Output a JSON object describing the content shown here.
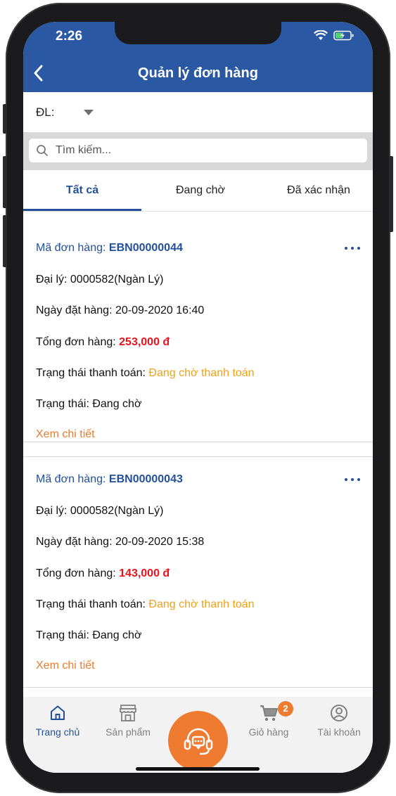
{
  "status_bar": {
    "time": "2:26"
  },
  "header": {
    "title": "Quản lý đơn hàng"
  },
  "filter": {
    "label": "ĐL:"
  },
  "search": {
    "placeholder": "Tìm kiếm..."
  },
  "tabs": [
    {
      "label": "Tất cả"
    },
    {
      "label": "Đang chờ"
    },
    {
      "label": "Đã xác nhận"
    }
  ],
  "orders": [
    {
      "code_label": "Mã đơn hàng:",
      "code": "EBN00000044",
      "agent_label": "Đại lý:",
      "agent": "0000582(Ngàn Lý)",
      "date_label": "Ngày đặt hàng:",
      "date": "20-09-2020 16:40",
      "total_label": "Tổng đơn hàng:",
      "total": "253,000 đ",
      "payment_label": "Trạng thái thanh toán:",
      "payment_status": "Đang chờ thanh toán",
      "status_label": "Trạng thái:",
      "status": "Đang chờ",
      "detail_link": "Xem chi tiết"
    },
    {
      "code_label": "Mã đơn hàng:",
      "code": "EBN00000043",
      "agent_label": "Đại lý:",
      "agent": "0000582(Ngàn Lý)",
      "date_label": "Ngày đặt hàng:",
      "date": "20-09-2020 15:38",
      "total_label": "Tổng đơn hàng:",
      "total": "143,000 đ",
      "payment_label": "Trạng thái thanh toán:",
      "payment_status": "Đang chờ thanh toán",
      "status_label": "Trạng thái:",
      "status": "Đang chờ",
      "detail_link": "Xem chi tiết"
    }
  ],
  "bottom_nav": {
    "items": [
      {
        "label": "Trang chủ",
        "icon": "home-icon"
      },
      {
        "label": "Sản phẩm",
        "icon": "store-icon"
      },
      {
        "label": "",
        "icon": "support-headset-icon"
      },
      {
        "label": "Giỏ hàng",
        "icon": "cart-icon"
      },
      {
        "label": "Tài khoản",
        "icon": "account-icon"
      }
    ],
    "cart_badge": "2"
  },
  "colors": {
    "primary": "#2a58a3",
    "accent": "#ee7b2f",
    "price": "#e8141e",
    "pending": "#f0a018"
  }
}
